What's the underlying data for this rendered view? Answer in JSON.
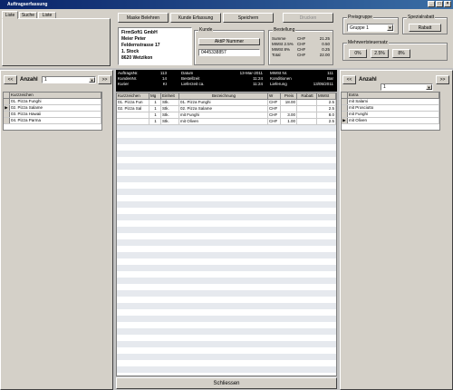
{
  "window": {
    "title": "Auftragserfassung"
  },
  "tabs": [
    "Liste",
    "Suche",
    "Liste"
  ],
  "toolbar": {
    "new_customer": "Maske Belehren",
    "customer_entry": "Kunde Erfassung",
    "save": "Speichern",
    "print": "Drucken"
  },
  "address": [
    "FirmSoft1 GmbH",
    "Meier Peter",
    "Feldernstrasse 17",
    "1. Stock",
    "8620 Wetzikon"
  ],
  "customer_box": {
    "title": "Kunde",
    "number_label": "AktiP Nummer",
    "phone": "0445338857"
  },
  "order_box": {
    "title": "Bestellung",
    "rows": [
      {
        "label": "Summe",
        "cur": "CHF",
        "value": "21.25"
      },
      {
        "label": "MWSt 2.5%",
        "cur": "CHF",
        "value": "0.50"
      },
      {
        "label": "MWSt 8%",
        "cur": "CHF",
        "value": "0.25"
      },
      {
        "label": "Total",
        "cur": "CHF",
        "value": "22.00"
      }
    ]
  },
  "price_group": {
    "title": "Preisgruppe",
    "value": "Gruppe 1"
  },
  "special_discount": {
    "title": "Spezialrabatt",
    "button": "Rabatt"
  },
  "vat_rates": {
    "title": "Mehrwertsteuersatz",
    "options": [
      "0%",
      "2.5%",
      "8%"
    ]
  },
  "left_nav": {
    "prev": "<<",
    "next": ">>",
    "amount_label": "Anzahl",
    "amount_value": "1"
  },
  "right_nav": {
    "prev": "<<",
    "next": ">>",
    "amount_label": "Anzahl",
    "amount_value": "1"
  },
  "left_list": {
    "header": "Kurzzeichen",
    "items": [
      "01. Pizza Funghi",
      "02. Pizza Salame",
      "03. Pizza Hawaii",
      "04. Pizza Parma"
    ]
  },
  "order_info": {
    "left": [
      {
        "label": "AuftragsNr.",
        "value": "113"
      },
      {
        "label": "KundenNr.",
        "value": "14"
      },
      {
        "label": "Kurier",
        "value": "KI"
      }
    ],
    "middle": [
      {
        "label": "Datum",
        "value": "13-Mar-2011"
      },
      {
        "label": "Bestellzeit",
        "value": "11:24"
      },
      {
        "label": "Lieferzeit ca.",
        "value": "11:24"
      }
    ],
    "right": [
      {
        "label": "MWSt Nr.",
        "value": "111"
      },
      {
        "label": "Konditionen",
        "value": "Bar"
      },
      {
        "label": "Lieferung",
        "value": "13/05/2011"
      }
    ]
  },
  "main_grid": {
    "headers": [
      "Kurzzeichen",
      "Mg",
      "Einheit",
      "Bezeichnung",
      "W",
      "Preis",
      "Rabatt",
      "MWSt"
    ],
    "rows": [
      [
        "01. Pizza Fun",
        "1",
        "Stk.",
        "01. Pizza Funghi",
        "CHF",
        "18.00",
        "",
        "2.5"
      ],
      [
        "02. Pizza Sal",
        "1",
        "Stk.",
        "02. Pizza Salame",
        "CHF",
        "",
        "",
        "2.5"
      ],
      [
        "",
        "1",
        "Stk.",
        "mit Funghi",
        "CHF",
        "3.00",
        "",
        "8.0"
      ],
      [
        "",
        "1",
        "Stk.",
        "mit Oliven",
        "CHF",
        "1.00",
        "",
        "2.5"
      ]
    ]
  },
  "right_list": {
    "header": "Extra",
    "items": [
      "mit Salami",
      "mit Prosciutto",
      "mit Funghi",
      "mit Oliven"
    ]
  },
  "footer": {
    "close": "Schliessen"
  }
}
